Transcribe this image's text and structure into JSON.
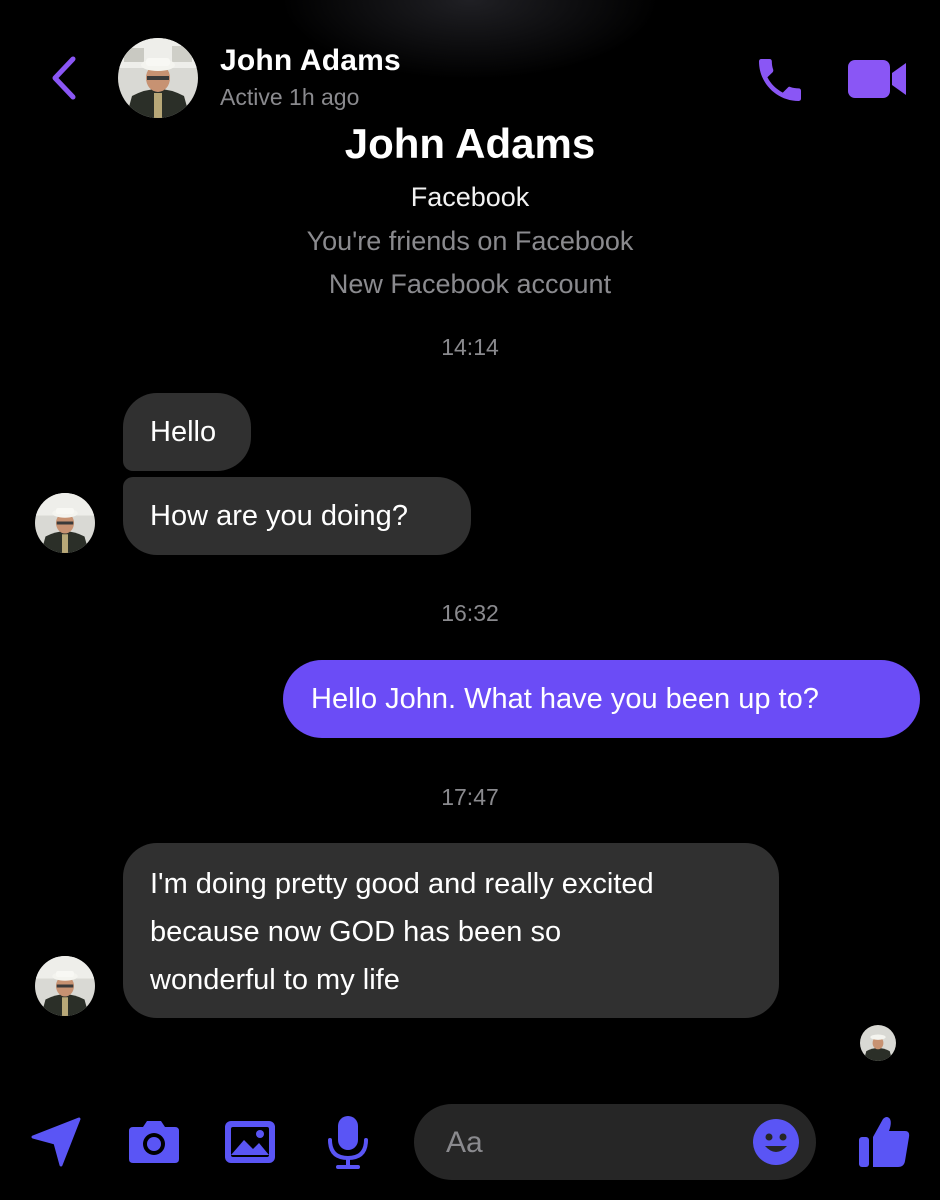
{
  "header": {
    "name": "John Adams",
    "status": "Active 1h ago",
    "icons": [
      "chevron-left-icon",
      "phone-icon",
      "video-camera-icon"
    ]
  },
  "profile_intro": {
    "name": "John Adams",
    "platform": "Facebook",
    "friendship": "You're friends on Facebook",
    "account_note": "New Facebook account"
  },
  "timestamps": [
    "14:14",
    "16:32",
    "17:47"
  ],
  "messages": [
    {
      "from": "John Adams",
      "text": "Hello"
    },
    {
      "from": "John Adams",
      "text": "How are you doing?"
    },
    {
      "from": "me",
      "text": "Hello John. What have you been up to?"
    },
    {
      "from": "John Adams",
      "lines": [
        "I'm doing pretty good and really excited",
        "because now GOD has been so",
        "wonderful to my life"
      ]
    }
  ],
  "composer": {
    "placeholder": "Aa",
    "icons": [
      "location-arrow-icon",
      "camera-icon",
      "image-icon",
      "microphone-icon",
      "emoji-icon",
      "thumbs-up-icon"
    ]
  },
  "colors": {
    "accent": "#8a56f5",
    "tool_accent": "#5a55f5",
    "outgoing_bubble": "#6b4cf6",
    "incoming_bubble": "#303030",
    "secondary_text": "#8a8a8e",
    "background": "#000000"
  }
}
